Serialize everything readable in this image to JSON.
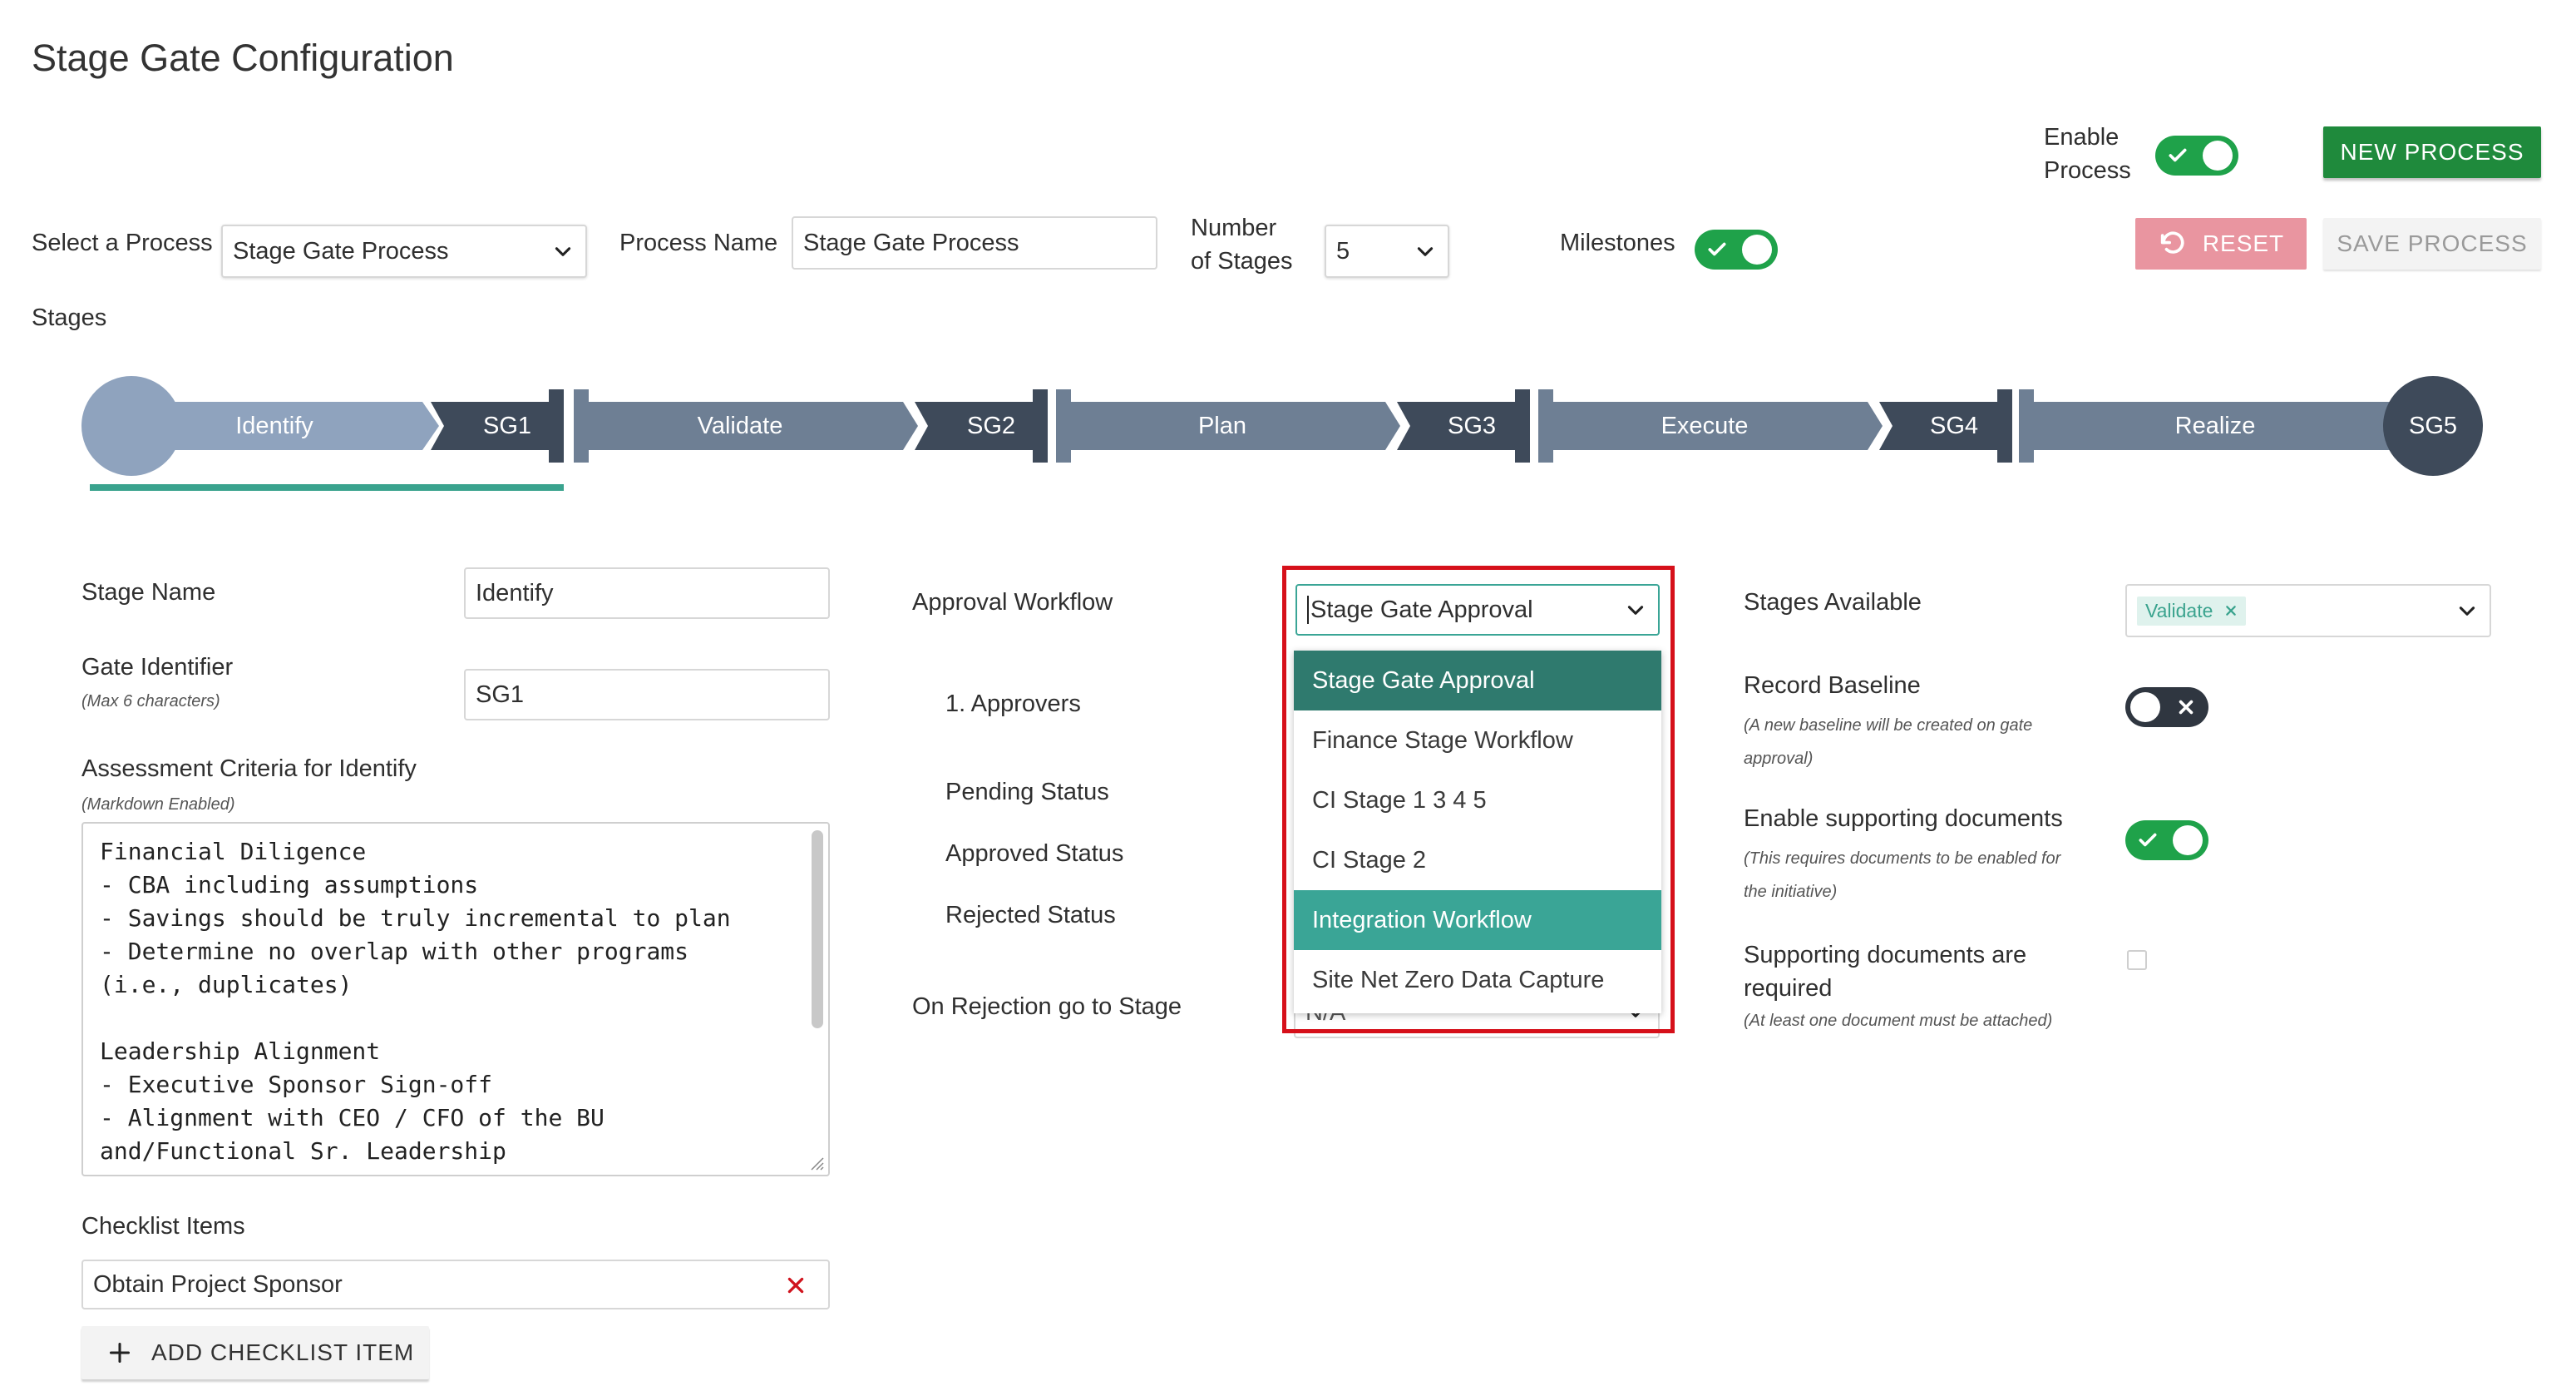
{
  "page": {
    "title": "Stage Gate Configuration"
  },
  "header_controls": {
    "enable_process_label_1": "Enable",
    "enable_process_label_2": "Process",
    "new_process_label": "NEW PROCESS",
    "reset_label": "RESET",
    "save_process_label": "SAVE PROCESS",
    "milestones_label": "Milestones"
  },
  "process": {
    "select_label": "Select a Process",
    "select_value": "Stage Gate Process",
    "name_label": "Process Name",
    "name_value": "Stage Gate Process",
    "num_stages_label_1": "Number",
    "num_stages_label_2": "of Stages",
    "num_stages_value": "5"
  },
  "stages": {
    "label": "Stages",
    "items": [
      "Identify",
      "SG1",
      "Validate",
      "SG2",
      "Plan",
      "SG3",
      "Execute",
      "SG4",
      "Realize",
      "SG5"
    ],
    "colors": {
      "active": "#8fa3be",
      "stage": "#6e7f94",
      "gate": "#3e4a5a",
      "underline": "#3aa38e"
    }
  },
  "stage_form": {
    "stage_name_label": "Stage Name",
    "stage_name_value": "Identify",
    "gate_identifier_label": "Gate Identifier",
    "gate_identifier_hint": "(Max 6 characters)",
    "gate_identifier_value": "SG1",
    "criteria_label": "Assessment Criteria for Identify",
    "criteria_hint": "(Markdown Enabled)",
    "criteria_lines": [
      "Financial Diligence",
      "- CBA including assumptions",
      "- Savings should be truly incremental to plan",
      "- Determine no overlap with other programs",
      "(i.e., duplicates)",
      "",
      "Leadership Alignment",
      "- Executive Sponsor Sign-off",
      "- Alignment with CEO / CFO of the BU",
      "and/Functional Sr. Leadership"
    ],
    "checklist_label": "Checklist Items",
    "checklist_item": "Obtain Project Sponsor",
    "add_checklist_label": "ADD CHECKLIST ITEM"
  },
  "workflow": {
    "approval_label": "Approval Workflow",
    "approval_value": "Stage Gate Approval",
    "approvers_label": "1. Approvers",
    "pending_label": "Pending Status",
    "approved_label": "Approved Status",
    "rejected_label": "Rejected Status",
    "rejection_label": "On Rejection go to Stage",
    "rejection_value": "N/A",
    "options": [
      "Stage Gate Approval",
      "Finance Stage Workflow",
      "CI Stage 1 3 4 5",
      "CI Stage 2",
      "Integration Workflow",
      "Site Net Zero Data Capture"
    ],
    "selected_index": 0,
    "hover_index": 4
  },
  "right_panel": {
    "stages_available_label": "Stages Available",
    "stages_available_chip": "Validate",
    "record_baseline_label": "Record Baseline",
    "record_baseline_hint_1": "(A new baseline will be created on gate",
    "record_baseline_hint_2": "approval)",
    "supporting_docs_label": "Enable supporting documents",
    "supporting_docs_hint_1": "(This requires documents to be enabled for",
    "supporting_docs_hint_2": "the initiative)",
    "docs_required_label_1": "Supporting documents are",
    "docs_required_label_2": "required",
    "docs_required_hint": "(At least one document must be attached)"
  },
  "toggles": {
    "enable_process": true,
    "milestones": true,
    "record_baseline": false,
    "supporting_docs": true,
    "docs_required": false
  },
  "icons": {
    "chevron": "chevron-down-icon",
    "reset": "undo-icon",
    "check": "check-icon",
    "close": "close-icon",
    "plus": "plus-icon"
  },
  "colors": {
    "primary_green": "#1f8a3c",
    "reset_pink": "#e995a0",
    "dropdown_selected": "#2f7a6e",
    "dropdown_hover": "#3aa596",
    "highlight_box": "#d6101a"
  }
}
